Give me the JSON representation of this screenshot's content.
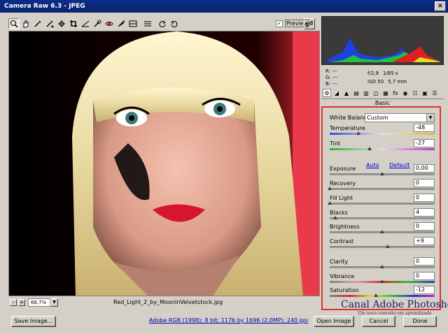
{
  "window": {
    "title": "Camera Raw 6.3  -  JPEG",
    "close": "×"
  },
  "toolbar": {
    "tools": [
      "zoom-icon",
      "hand-icon",
      "white-balance-icon",
      "color-sampler-icon",
      "target-adjust-icon",
      "crop-icon",
      "straighten-icon",
      "spot-removal-icon",
      "red-eye-icon",
      "adjustment-brush-icon",
      "graduated-filter-icon",
      "preferences-icon",
      "rotate-left-icon",
      "rotate-right-icon"
    ]
  },
  "preview": {
    "label": "Preview",
    "checked": "✓"
  },
  "image": {
    "filename": "Red_Light_2_by_MoonInVelvetstock.jpg",
    "zoom": "66,7%"
  },
  "readout": {
    "r": "R:",
    "g": "G:",
    "b": "B:",
    "dash": "---",
    "aperture": "f/2,9",
    "shutter": "1/85 s",
    "iso": "ISO 50",
    "focal": "5,7 mm"
  },
  "panel": {
    "title": "Basic",
    "white_balance_label": "White Balance:",
    "white_balance_value": "Custom",
    "auto": "Auto",
    "default": "Default",
    "sliders": [
      {
        "label": "Temperature",
        "value": "-48",
        "pos": 0.27
      },
      {
        "label": "Tint",
        "value": "-27",
        "pos": 0.38
      },
      {
        "label": "Exposure",
        "value": "0,00",
        "pos": 0.5
      },
      {
        "label": "Recovery",
        "value": "0",
        "pos": 0.0
      },
      {
        "label": "Fill Light",
        "value": "0",
        "pos": 0.0
      },
      {
        "label": "Blacks",
        "value": "4",
        "pos": 0.05
      },
      {
        "label": "Brightness",
        "value": "0",
        "pos": 0.5
      },
      {
        "label": "Contrast",
        "value": "+9",
        "pos": 0.55
      },
      {
        "label": "Clarity",
        "value": "0",
        "pos": 0.5
      },
      {
        "label": "Vibrance",
        "value": "0",
        "pos": 0.5
      },
      {
        "label": "Saturation",
        "value": "-12",
        "pos": 0.44
      }
    ]
  },
  "footer": {
    "save": "Save Image...",
    "color_info": "Adobe RGB (1998); 8 bit; 1176 by 1696 (2,0MP); 240 ppi",
    "open": "Open Image",
    "cancel": "Cancel",
    "done": "Done"
  },
  "watermark": {
    "title": "Canal Adobe Photoshop",
    "subtitle": "Um novo conceito em aprendizado"
  },
  "colors": {
    "accent_red": "#e03030",
    "title_blue": "#0a246a",
    "link_blue": "#0000cc"
  }
}
